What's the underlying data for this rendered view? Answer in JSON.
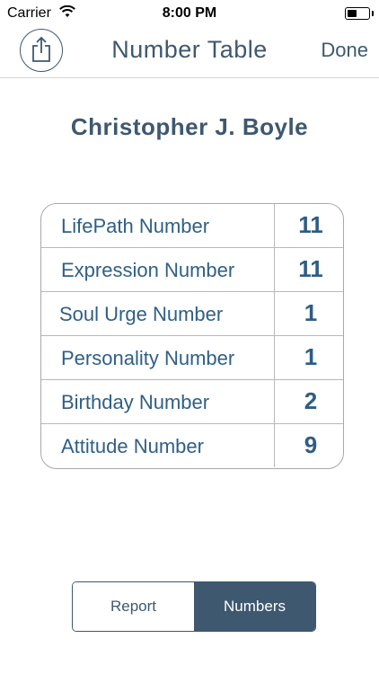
{
  "status_bar": {
    "carrier": "Carrier",
    "time": "8:00 PM"
  },
  "nav": {
    "title": "Number Table",
    "done_label": "Done"
  },
  "person": {
    "name": "Christopher J. Boyle"
  },
  "table": {
    "rows": [
      {
        "label": "LifePath Number",
        "value": "11"
      },
      {
        "label": "Expression Number",
        "value": "11"
      },
      {
        "label": "Soul Urge Number",
        "value": "1"
      },
      {
        "label": "Personality Number",
        "value": "1"
      },
      {
        "label": "Birthday Number",
        "value": "2"
      },
      {
        "label": "Attitude Number",
        "value": "9"
      }
    ]
  },
  "segment": {
    "report_label": "Report",
    "numbers_label": "Numbers",
    "selected": "Numbers"
  },
  "colors": {
    "accent": "#3e5870",
    "value": "#2d5d84",
    "border": "#a9a9a9"
  }
}
